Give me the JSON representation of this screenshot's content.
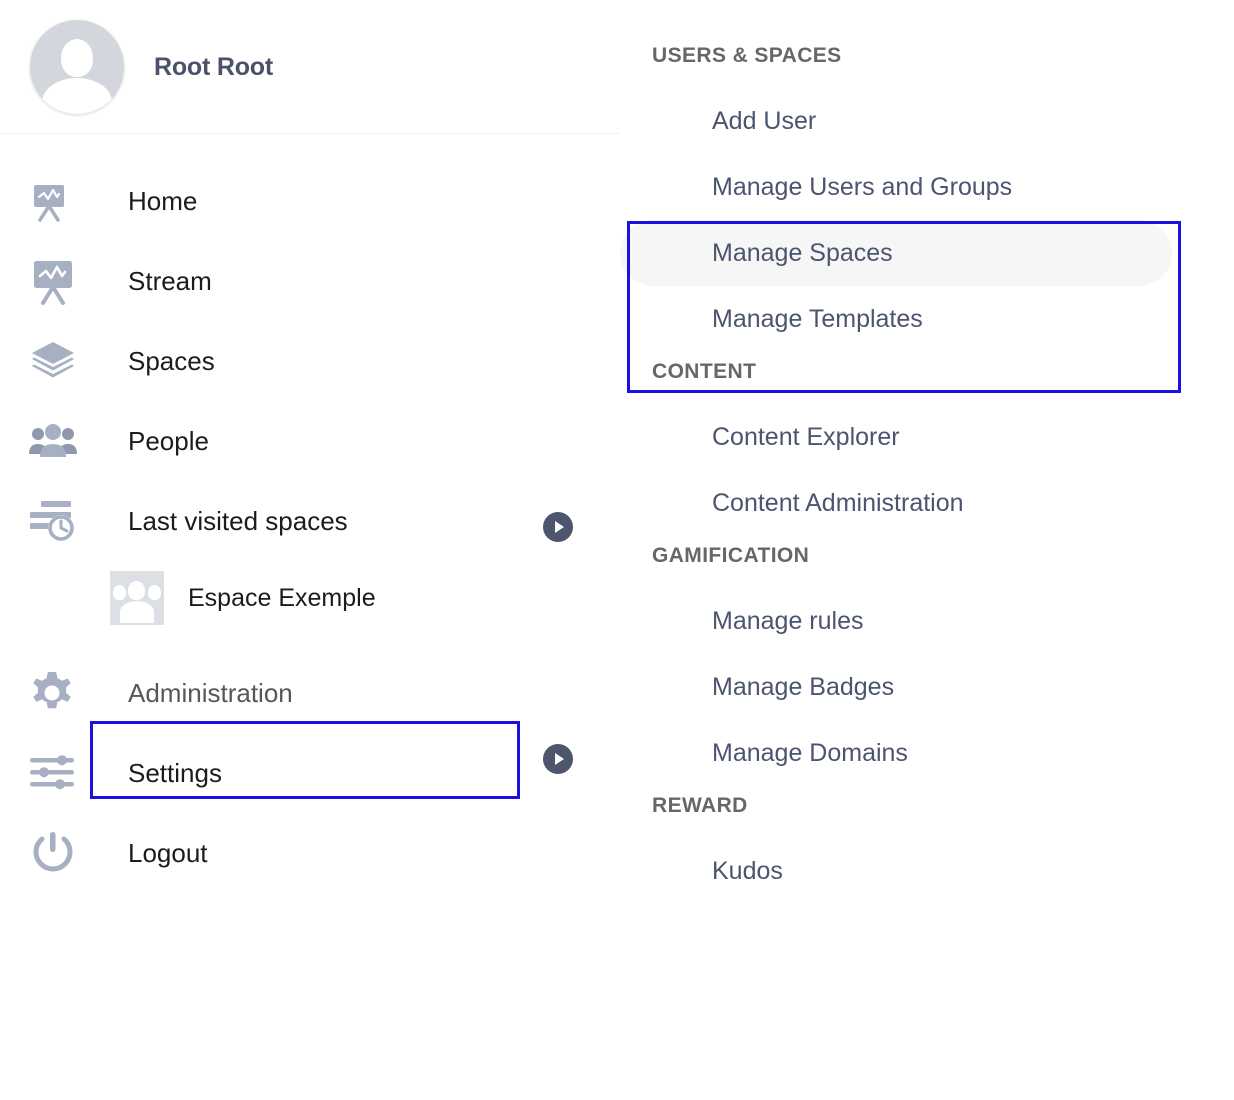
{
  "sidebar": {
    "profile": {
      "name": "Root Root",
      "avatar_icon": "user-avatar-icon"
    },
    "items": [
      {
        "label": "Home",
        "icon": "stream-board-icon"
      },
      {
        "label": "Stream",
        "icon": "stream-board-icon"
      },
      {
        "label": "Spaces",
        "icon": "layers-icon"
      },
      {
        "label": "People",
        "icon": "people-group-icon"
      },
      {
        "label": "Last visited spaces",
        "icon": "recent-clock-icon",
        "expandable": true
      },
      {
        "label": "Administration",
        "icon": "gear-icon",
        "expandable": true,
        "highlighted": true,
        "muted": true
      },
      {
        "label": "Settings",
        "icon": "sliders-icon"
      },
      {
        "label": "Logout",
        "icon": "power-icon"
      }
    ],
    "space": {
      "label": "Espace Exemple",
      "icon": "space-group-avatar-icon"
    },
    "expander_icon": "chevron-right-circle-icon"
  },
  "right_panel": {
    "sections": [
      {
        "title": "USERS & SPACES",
        "items": [
          {
            "label": "Add User"
          },
          {
            "label": "Manage Users and Groups"
          },
          {
            "label": "Manage Spaces",
            "selected": true
          },
          {
            "label": "Manage Templates"
          }
        ]
      },
      {
        "title": "CONTENT",
        "items": [
          {
            "label": "Content Explorer"
          },
          {
            "label": "Content Administration"
          }
        ]
      },
      {
        "title": "GAMIFICATION",
        "items": [
          {
            "label": "Manage rules"
          },
          {
            "label": "Manage Badges"
          },
          {
            "label": "Manage Domains"
          }
        ]
      },
      {
        "title": "REWARD",
        "items": [
          {
            "label": "Kudos"
          }
        ]
      }
    ]
  },
  "annotations": {
    "highlight_color": "#1a12e0",
    "admin_box_label": "Administration",
    "spaces_box_labels": "Manage Spaces / Manage Templates"
  },
  "colors": {
    "sidebar_label": "#1c1c1c",
    "menu_link": "#4c5470",
    "section_head": "#666769",
    "icon_fill": "#a7b0c2",
    "selected_pill": "#f6f6f7",
    "expander_bg": "#4e566e"
  }
}
